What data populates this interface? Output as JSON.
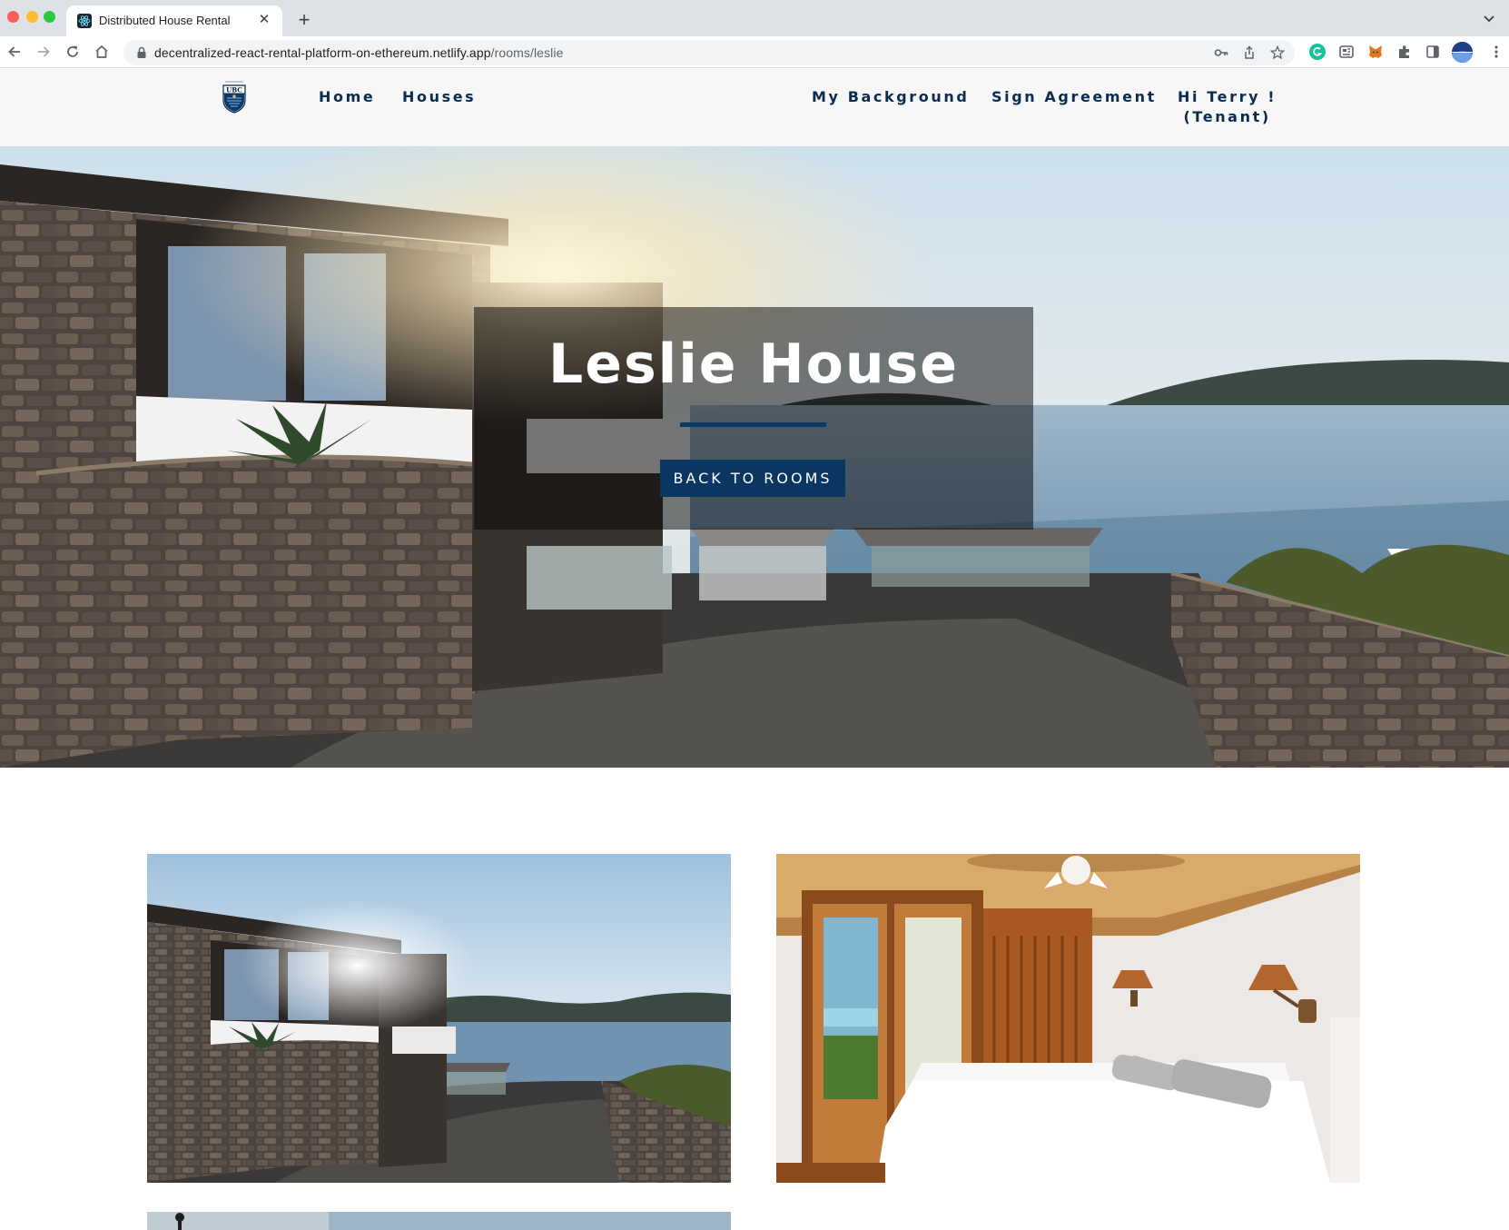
{
  "browser": {
    "tab_title": "Distributed House Rental",
    "url_host": "decentralized-react-rental-platform-on-ethereum.netlify.app",
    "url_path": "/rooms/leslie"
  },
  "nav": {
    "links": [
      "Home",
      "Houses",
      "My Background",
      "Sign Agreement"
    ],
    "greeting": "Hi Terry !",
    "role": "(Tenant)"
  },
  "hero": {
    "title": "Leslie House",
    "button": "BACK TO ROOMS"
  },
  "colors": {
    "brand_navy": "#0a3761",
    "nav_text": "#0b2c4f"
  },
  "icons": [
    "back-icon",
    "forward-icon",
    "reload-icon",
    "home-icon",
    "lock-icon",
    "key-icon",
    "share-icon",
    "star-icon",
    "grammarly-icon",
    "extension-icon",
    "metamask-icon",
    "puzzle-icon",
    "sidebar-icon",
    "profile-avatar",
    "ubc-logo"
  ]
}
